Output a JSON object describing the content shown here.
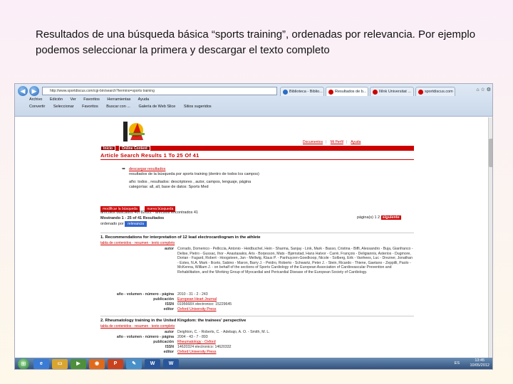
{
  "slide": {
    "caption": "Resultados de una búsqueda básica  “sports training”, ordenadas por relevancia. Por ejemplo podemos seleccionar la primera y descargar el texto completo"
  },
  "browser": {
    "address": "http://www.sportdiscus.com/cgi-bin/search?termino=sports training",
    "tabs": [
      "Biblioteca - Biblio...",
      "Resultados de b...",
      "IliInk Universitat ...",
      "sportdiscus.com"
    ],
    "menu": [
      "Archivo",
      "Edición",
      "Ver",
      "Favoritos",
      "Herramientas",
      "Ayuda"
    ],
    "favorites": [
      "Convertir",
      "Seleccionar",
      "Favoritos",
      "Buscar con ...",
      "Galería de Web Slice",
      "Sitios sugeridos"
    ]
  },
  "page": {
    "toplinks": [
      "Documentos",
      "Mi Perfil",
      "Ayuda"
    ],
    "nav_tabs": [
      "Inicio",
      "Online Content"
    ],
    "results_title": "Article Search Results 1 To 25 Of 41",
    "search": {
      "link": "descargar resultados",
      "line1": "resultados de la búsqueda por sports training (dentro de todos los campos)",
      "line2": "año: todos , resultados: descriptores , autor, campos, lenguaje, página",
      "line3": "categorías: all, all, base de datos: Sports Med"
    },
    "buttons": [
      "modificar la búsqueda",
      "nueva búsqueda"
    ],
    "meta": {
      "line1": "artículos buscados 40782622 - artículos encontrados 41",
      "line2": "Mostrando 1 - 25 of 41 Resultados",
      "line3_label": "ordenado por",
      "sort_value": "relevancia"
    },
    "pagination": {
      "label": "página(s) 1 2",
      "next": "siguiente"
    },
    "results": [
      {
        "title": "1. Recommendations for interpretation of 12 lead electrocardiogram in the athlete",
        "links": "tabla de contenidos - resumen - texto completo",
        "fields": [
          {
            "label": "autor",
            "value": "Corrado, Domenico - Pelliccia, Antonio - Heidbuchel, Hein - Sharma, Sanjay - Link, Mark - Basso, Cristina - Biffi, Alessandro - Buja, Gianfranco - Delise, Pietro - Gussac, Ihor - Anastasakis, Aris - Borjesson, Mats - Bjørnstad, Hans Halvor - Carrè, François - Deligiannis, Asterios - Dugmore, Dorian - Fagard, Robert - Hoogsteen, Jan - Mellwig, Klaus P. - Panhuyzen-Goedkoop, Nicole - Solberg, Erik - Vanhees, Luc - Drezner, Jonathan - Estes, N.A. Mark - Iliceto, Sabino - Maron, Barry J. - Peidro, Roberto - Schwartz, Peter J. - Stein, Ricardo - Thiene, Gaetano - Zeppilli, Paolo - McKenna, William J. - on behalf of the sections of Sports Cardiology of the European Association of Cardiovascular Prevention and Rehabilitation, and the Working Group of Myocardial and Pericardial Disease of the European Society of Cardiology.",
            "red": false
          },
          {
            "label": "año - volumen - número - página",
            "value": "2010 - 31 - 2 - 243",
            "red": false
          },
          {
            "label": "publicación",
            "value": "European Heart Journal",
            "red": true
          },
          {
            "label": "ISSN",
            "value": "0195668X          electronico: 15229645",
            "red": false
          },
          {
            "label": "editor",
            "value": "Oxford University Press",
            "red": true
          }
        ]
      },
      {
        "title": "2. Rheumatology training in the United Kingdom: the trainees' perspective",
        "links": "tabla de contenidos - resumen - texto completo",
        "fields": [
          {
            "label": "autor",
            "value": "Deighton, C. - Roberts, C. - Adebajo, A. O. - Smith, M. L.",
            "red": false
          },
          {
            "label": "año - volumen - número - página",
            "value": "2004 - 43 - 7 - 893",
            "red": false
          },
          {
            "label": "publicación",
            "value": "Rheumatology - Oxford",
            "red": true
          },
          {
            "label": "ISSN",
            "value": "14620324          electronico: 14620332",
            "red": false
          },
          {
            "label": "editor",
            "value": "Oxford University Press",
            "red": true
          }
        ]
      }
    ]
  },
  "taskbar": {
    "apps": [
      "IE",
      "Folder",
      "Media",
      "Firefox",
      "PowerPoint",
      "Paint",
      "Word",
      "Word 2"
    ],
    "tray": "ES",
    "time": "13:45",
    "date": "10/05/2012"
  },
  "colors": {
    "accent_red": "#cc0000",
    "taskbar": "#2b4a74"
  }
}
